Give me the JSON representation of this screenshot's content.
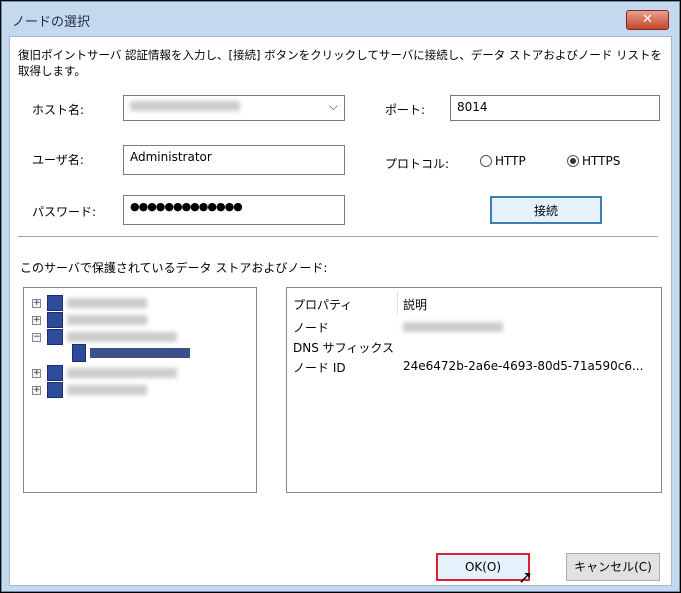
{
  "window": {
    "title": "ノードの選択",
    "close": "✕"
  },
  "description": "復旧ポイントサーバ 認証情報を入力し、[接続] ボタンをクリックしてサーバに接続し、データ ストアおよびノード リストを取得します。",
  "form": {
    "host_label": "ホスト名:",
    "port_label": "ポート:",
    "port_value": "8014",
    "user_label": "ユーザ名:",
    "user_value": "Administrator",
    "protocol_label": "プロトコル:",
    "protocol_options": [
      "HTTP",
      "HTTPS"
    ],
    "protocol_selected": "HTTPS",
    "password_label": "パスワード:",
    "password_value": "●●●●●●●●●●●●●",
    "connect_button": "接続"
  },
  "tree_label": "このサーバで保護されているデータ ストアおよびノード:",
  "properties": {
    "headers": [
      "プロパティ",
      "説明"
    ],
    "rows": [
      {
        "name": "ノード",
        "value": ""
      },
      {
        "name": "DNS サフィックス",
        "value": ""
      },
      {
        "name": "ノード ID",
        "value": "24e6472b-2a6e-4693-80d5-71a590c6..."
      }
    ]
  },
  "buttons": {
    "ok": "OK(O)",
    "cancel": "キャンセル(C)"
  },
  "colors": {
    "ok_border": "#e0202c",
    "connect_border": "#3c7fb1"
  }
}
